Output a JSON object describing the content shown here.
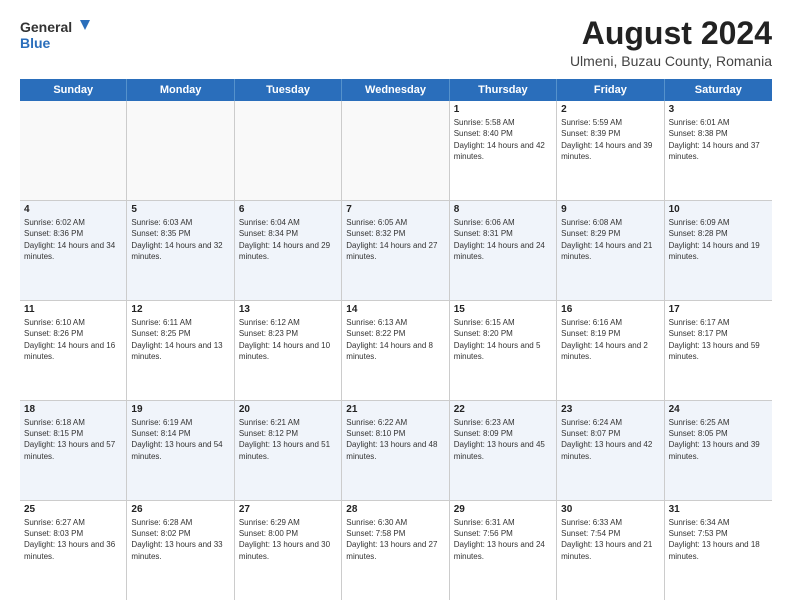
{
  "logo": {
    "general": "General",
    "blue": "Blue"
  },
  "title": "August 2024",
  "location": "Ulmeni, Buzau County, Romania",
  "weekdays": [
    "Sunday",
    "Monday",
    "Tuesday",
    "Wednesday",
    "Thursday",
    "Friday",
    "Saturday"
  ],
  "rows": [
    [
      {
        "day": "",
        "info": ""
      },
      {
        "day": "",
        "info": ""
      },
      {
        "day": "",
        "info": ""
      },
      {
        "day": "",
        "info": ""
      },
      {
        "day": "1",
        "info": "Sunrise: 5:58 AM\nSunset: 8:40 PM\nDaylight: 14 hours and 42 minutes."
      },
      {
        "day": "2",
        "info": "Sunrise: 5:59 AM\nSunset: 8:39 PM\nDaylight: 14 hours and 39 minutes."
      },
      {
        "day": "3",
        "info": "Sunrise: 6:01 AM\nSunset: 8:38 PM\nDaylight: 14 hours and 37 minutes."
      }
    ],
    [
      {
        "day": "4",
        "info": "Sunrise: 6:02 AM\nSunset: 8:36 PM\nDaylight: 14 hours and 34 minutes."
      },
      {
        "day": "5",
        "info": "Sunrise: 6:03 AM\nSunset: 8:35 PM\nDaylight: 14 hours and 32 minutes."
      },
      {
        "day": "6",
        "info": "Sunrise: 6:04 AM\nSunset: 8:34 PM\nDaylight: 14 hours and 29 minutes."
      },
      {
        "day": "7",
        "info": "Sunrise: 6:05 AM\nSunset: 8:32 PM\nDaylight: 14 hours and 27 minutes."
      },
      {
        "day": "8",
        "info": "Sunrise: 6:06 AM\nSunset: 8:31 PM\nDaylight: 14 hours and 24 minutes."
      },
      {
        "day": "9",
        "info": "Sunrise: 6:08 AM\nSunset: 8:29 PM\nDaylight: 14 hours and 21 minutes."
      },
      {
        "day": "10",
        "info": "Sunrise: 6:09 AM\nSunset: 8:28 PM\nDaylight: 14 hours and 19 minutes."
      }
    ],
    [
      {
        "day": "11",
        "info": "Sunrise: 6:10 AM\nSunset: 8:26 PM\nDaylight: 14 hours and 16 minutes."
      },
      {
        "day": "12",
        "info": "Sunrise: 6:11 AM\nSunset: 8:25 PM\nDaylight: 14 hours and 13 minutes."
      },
      {
        "day": "13",
        "info": "Sunrise: 6:12 AM\nSunset: 8:23 PM\nDaylight: 14 hours and 10 minutes."
      },
      {
        "day": "14",
        "info": "Sunrise: 6:13 AM\nSunset: 8:22 PM\nDaylight: 14 hours and 8 minutes."
      },
      {
        "day": "15",
        "info": "Sunrise: 6:15 AM\nSunset: 8:20 PM\nDaylight: 14 hours and 5 minutes."
      },
      {
        "day": "16",
        "info": "Sunrise: 6:16 AM\nSunset: 8:19 PM\nDaylight: 14 hours and 2 minutes."
      },
      {
        "day": "17",
        "info": "Sunrise: 6:17 AM\nSunset: 8:17 PM\nDaylight: 13 hours and 59 minutes."
      }
    ],
    [
      {
        "day": "18",
        "info": "Sunrise: 6:18 AM\nSunset: 8:15 PM\nDaylight: 13 hours and 57 minutes."
      },
      {
        "day": "19",
        "info": "Sunrise: 6:19 AM\nSunset: 8:14 PM\nDaylight: 13 hours and 54 minutes."
      },
      {
        "day": "20",
        "info": "Sunrise: 6:21 AM\nSunset: 8:12 PM\nDaylight: 13 hours and 51 minutes."
      },
      {
        "day": "21",
        "info": "Sunrise: 6:22 AM\nSunset: 8:10 PM\nDaylight: 13 hours and 48 minutes."
      },
      {
        "day": "22",
        "info": "Sunrise: 6:23 AM\nSunset: 8:09 PM\nDaylight: 13 hours and 45 minutes."
      },
      {
        "day": "23",
        "info": "Sunrise: 6:24 AM\nSunset: 8:07 PM\nDaylight: 13 hours and 42 minutes."
      },
      {
        "day": "24",
        "info": "Sunrise: 6:25 AM\nSunset: 8:05 PM\nDaylight: 13 hours and 39 minutes."
      }
    ],
    [
      {
        "day": "25",
        "info": "Sunrise: 6:27 AM\nSunset: 8:03 PM\nDaylight: 13 hours and 36 minutes."
      },
      {
        "day": "26",
        "info": "Sunrise: 6:28 AM\nSunset: 8:02 PM\nDaylight: 13 hours and 33 minutes."
      },
      {
        "day": "27",
        "info": "Sunrise: 6:29 AM\nSunset: 8:00 PM\nDaylight: 13 hours and 30 minutes."
      },
      {
        "day": "28",
        "info": "Sunrise: 6:30 AM\nSunset: 7:58 PM\nDaylight: 13 hours and 27 minutes."
      },
      {
        "day": "29",
        "info": "Sunrise: 6:31 AM\nSunset: 7:56 PM\nDaylight: 13 hours and 24 minutes."
      },
      {
        "day": "30",
        "info": "Sunrise: 6:33 AM\nSunset: 7:54 PM\nDaylight: 13 hours and 21 minutes."
      },
      {
        "day": "31",
        "info": "Sunrise: 6:34 AM\nSunset: 7:53 PM\nDaylight: 13 hours and 18 minutes."
      }
    ]
  ]
}
